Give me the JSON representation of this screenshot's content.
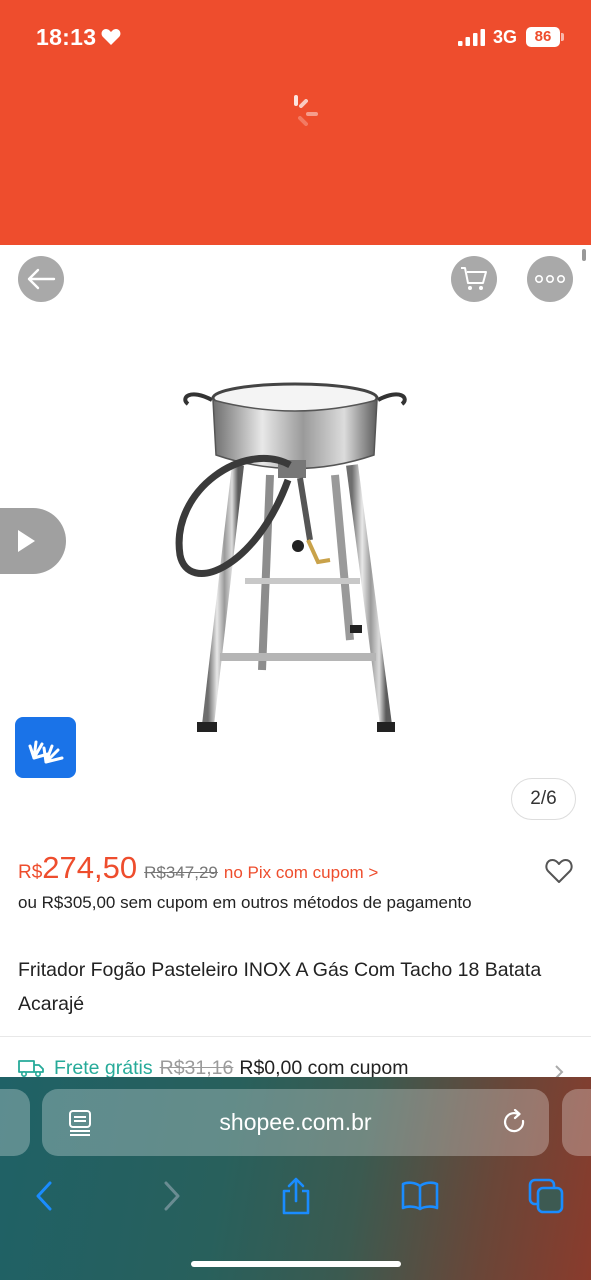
{
  "status_bar": {
    "time": "18:13",
    "network": "3G",
    "battery": "86"
  },
  "product": {
    "image_counter": "2/6",
    "price_currency": "R$",
    "price_value": "274,50",
    "price_old": "R$347,29",
    "price_pix_note": "no Pix com cupom >",
    "alt_price": "ou R$305,00 sem cupom em outros métodos de pagamento",
    "title": "Fritador Fogão Pasteleiro INOX A Gás Com Tacho 18 Batata Acarajé"
  },
  "shipping": {
    "free_label": "Frete grátis",
    "old_price": "R$31,16",
    "new_price": "R$0,00 com cupom"
  },
  "browser": {
    "url": "shopee.com.br"
  },
  "colors": {
    "brand": "#ee4d2d",
    "free_shipping": "#26aa99",
    "libras_button": "#1a73e8"
  },
  "icons": {
    "back": "arrow-left-icon",
    "cart": "cart-icon",
    "more": "ellipsis-icon",
    "video": "play-icon",
    "libras": "sign-language-icon",
    "favorite": "heart-outline-icon",
    "shipping": "truck-icon",
    "reader": "reader-mode-icon",
    "reload": "reload-icon"
  }
}
